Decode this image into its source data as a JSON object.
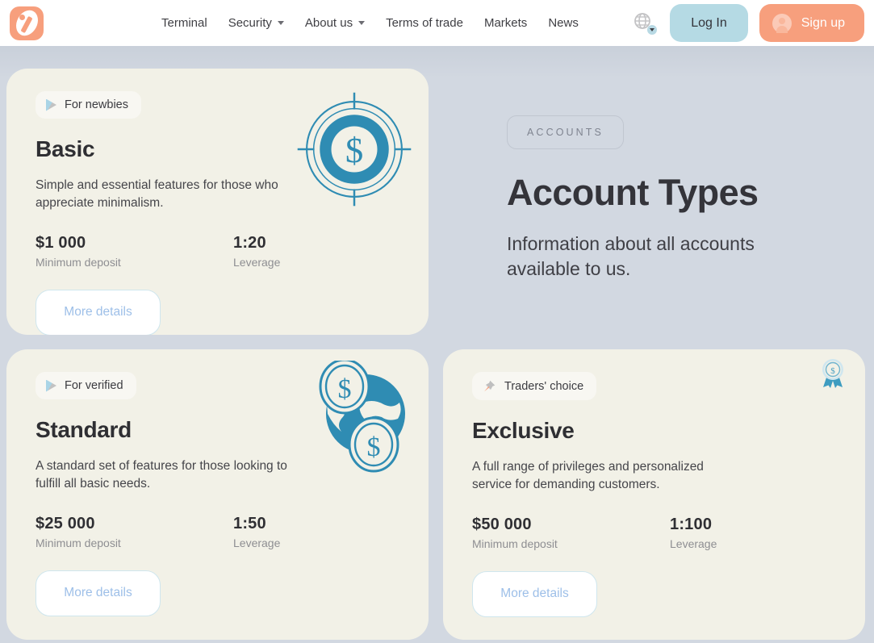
{
  "header": {
    "logo_name": "logo-icon",
    "nav": [
      {
        "label": "Terminal",
        "has_dropdown": false
      },
      {
        "label": "Security",
        "has_dropdown": true
      },
      {
        "label": "About us",
        "has_dropdown": true
      },
      {
        "label": "Terms of trade",
        "has_dropdown": false
      },
      {
        "label": "Markets",
        "has_dropdown": false
      },
      {
        "label": "News",
        "has_dropdown": false
      }
    ],
    "language_icon": "globe-icon",
    "login_label": "Log In",
    "signup_label": "Sign up"
  },
  "hero": {
    "eyebrow": "ACCOUNTS",
    "title": "Account Types",
    "subtitle": "Information about all accounts available to us."
  },
  "cards": [
    {
      "badge": "For newbies",
      "badge_icon": "flag-icon",
      "title": "Basic",
      "description": "Simple and essential features for those who appreciate minimalism.",
      "deposit_value": "$1 000",
      "deposit_label": "Minimum deposit",
      "leverage_value": "1:20",
      "leverage_label": "Leverage",
      "button": "More details",
      "illustration": "target-dollar-icon"
    },
    {
      "badge": "For verified",
      "badge_icon": "flag-icon",
      "title": "Standard",
      "description": "A standard set of features for those looking to fulfill all basic needs.",
      "deposit_value": "$25 000",
      "deposit_label": "Minimum deposit",
      "leverage_value": "1:50",
      "leverage_label": "Leverage",
      "button": "More details",
      "illustration": "globe-coins-icon"
    },
    {
      "badge": "Traders' choice",
      "badge_icon": "pushpin-icon",
      "title": "Exclusive",
      "description": "A full range of privileges and personalized service for demanding customers.",
      "deposit_value": "$50 000",
      "deposit_label": "Minimum deposit",
      "leverage_value": "1:100",
      "leverage_label": "Leverage",
      "button": "More details",
      "illustration": "award-ribbon-icon"
    }
  ],
  "colors": {
    "page_background": "#d2d8e1",
    "card_background": "#f2f1e7",
    "accent_orange": "#f79f7d",
    "accent_blue": "#b5dae4",
    "illustration_teal": "#2f8cb3",
    "text_dark": "#2f2f33",
    "text_muted": "#8e8e92"
  }
}
